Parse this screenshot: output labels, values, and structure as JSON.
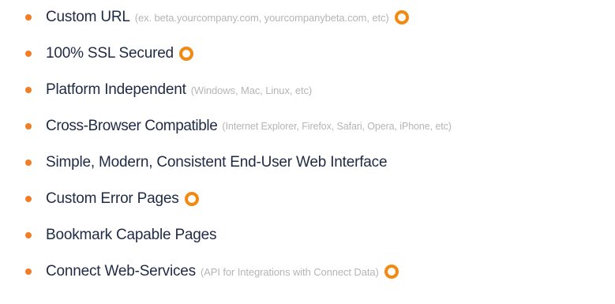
{
  "features": [
    {
      "title": "Custom URL",
      "note": "(ex. beta.yourcompany.com, yourcompanybeta.com, etc)",
      "premium_icon": "orange-ring-icon"
    },
    {
      "title": "100% SSL Secured",
      "note": "",
      "premium_icon": "orange-ring-icon"
    },
    {
      "title": "Platform Independent",
      "note": "(Windows, Mac, Linux, etc)",
      "premium_icon": ""
    },
    {
      "title": "Cross-Browser Compatible",
      "note": "(Internet Explorer, Firefox, Safari, Opera, iPhone, etc)",
      "premium_icon": ""
    },
    {
      "title": "Simple, Modern, Consistent End-User Web Interface",
      "note": "",
      "premium_icon": ""
    },
    {
      "title": "Custom Error Pages",
      "note": "",
      "premium_icon": "orange-ring-icon"
    },
    {
      "title": "Bookmark Capable Pages",
      "note": "",
      "premium_icon": ""
    },
    {
      "title": "Connect Web-Services",
      "note": "(API for Integrations with Connect Data)",
      "premium_icon": "orange-ring-icon"
    }
  ],
  "colors": {
    "bullet": "#f27d27",
    "title_text": "#1f2a44",
    "note_text": "#b5b5b5",
    "premium_icon": "#f28a12"
  }
}
